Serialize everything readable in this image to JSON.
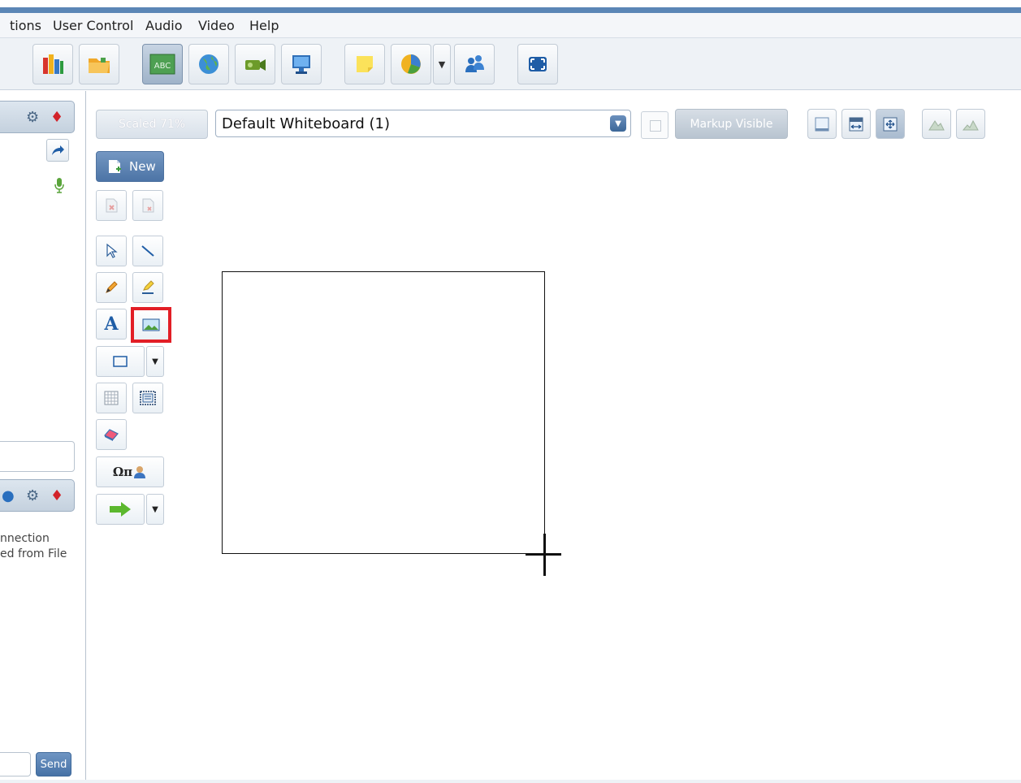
{
  "menu": {
    "items": [
      "tions",
      "User Control",
      "Audio",
      "Video",
      "Help"
    ]
  },
  "toolbar": {
    "buttons": [
      "library-icon",
      "open-folder-icon",
      "whiteboard-abc-icon",
      "web-globe-icon",
      "video-camera-icon",
      "desktop-share-icon",
      "sticky-note-icon",
      "poll-pie-icon",
      "participants-icon",
      "fullscreen-icon"
    ],
    "whiteboard_label": "ABC"
  },
  "left_panel": {
    "connection_line1": "nnection",
    "connection_line2": "ed from File",
    "send_label": "Send"
  },
  "whiteboard": {
    "scaled_label": "Scaled 71%",
    "board_name": "Default Whiteboard (1)",
    "markup_label": "Markup Visible",
    "new_label": "New",
    "text_tool_label": "A",
    "symbols_label": "Ωπ"
  },
  "colors": {
    "title_stripe": "#5b86b6",
    "accent_button": "#4c74a6",
    "selected_tool_border": "#e21e26"
  }
}
